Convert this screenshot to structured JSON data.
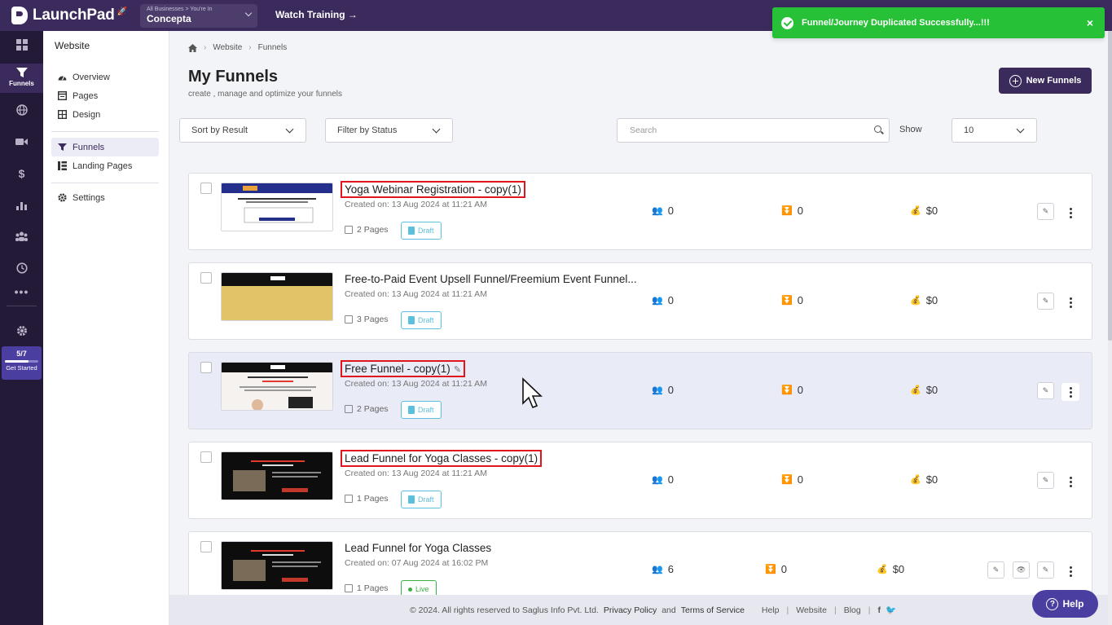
{
  "app": {
    "name": "LaunchPad"
  },
  "business": {
    "caption": "All Businesses > You're In",
    "name": "Concepta"
  },
  "topnav": {
    "watch_training": "Watch Training →"
  },
  "toast": {
    "message": "Funnel/Journey Duplicated Successfully...!!!",
    "close": "×",
    "color": "#27c137"
  },
  "rail": {
    "funnels_label": "Funnels",
    "get_started": {
      "count": "5/7",
      "label": "Get Started",
      "progress": 0.71
    }
  },
  "sidebar": {
    "title": "Website",
    "items": [
      {
        "label": "Overview",
        "icon": "gauge-icon"
      },
      {
        "label": "Pages",
        "icon": "pages-icon"
      },
      {
        "label": "Design",
        "icon": "design-icon"
      },
      {
        "label": "Funnels",
        "icon": "funnel-icon",
        "active": true
      },
      {
        "label": "Landing Pages",
        "icon": "landing-pages-icon"
      },
      {
        "label": "Settings",
        "icon": "gear-icon"
      }
    ]
  },
  "breadcrumb": {
    "items": [
      "Website",
      "Funnels"
    ]
  },
  "page": {
    "title": "My Funnels",
    "subtitle": "create , manage and optimize your funnels",
    "new_button": "New Funnels"
  },
  "filters": {
    "sort": "Sort by Result",
    "status": "Filter by Status",
    "search_placeholder": "Search",
    "show_label": "Show",
    "show_value": "10"
  },
  "funnels": [
    {
      "name": "Yoga Webinar Registration - copy(1)",
      "created": "Created on: 13 Aug 2024 at 11:21 AM",
      "pages": "2 Pages",
      "status": "Draft",
      "contacts": "0",
      "conversions": "0",
      "revenue": "$0"
    },
    {
      "name": "Free-to-Paid Event Upsell Funnel/Freemium Event Funnel...",
      "created": "Created on: 13 Aug 2024 at 11:21 AM",
      "pages": "3 Pages",
      "status": "Draft",
      "contacts": "0",
      "conversions": "0",
      "revenue": "$0"
    },
    {
      "name": "Free Funnel - copy(1)",
      "created": "Created on: 13 Aug 2024 at 11:21 AM",
      "pages": "2 Pages",
      "status": "Draft",
      "contacts": "0",
      "conversions": "0",
      "revenue": "$0"
    },
    {
      "name": "Lead Funnel for Yoga Classes - copy(1)",
      "created": "Created on: 13 Aug 2024 at 11:21 AM",
      "pages": "1 Pages",
      "status": "Draft",
      "contacts": "0",
      "conversions": "0",
      "revenue": "$0"
    },
    {
      "name": "Lead Funnel for Yoga Classes",
      "created": "Created on: 07 Aug 2024 at 16:02 PM",
      "pages": "1 Pages",
      "status": "Live",
      "contacts": "6",
      "conversions": "0",
      "revenue": "$0"
    }
  ],
  "footer": {
    "copyright": "© 2024. All rights reserved to Saglus Info Pvt. Ltd.",
    "privacy": "Privacy Policy",
    "and": "and",
    "terms": "Terms of Service",
    "help": "Help",
    "website": "Website",
    "blog": "Blog"
  },
  "help_button": "Help"
}
